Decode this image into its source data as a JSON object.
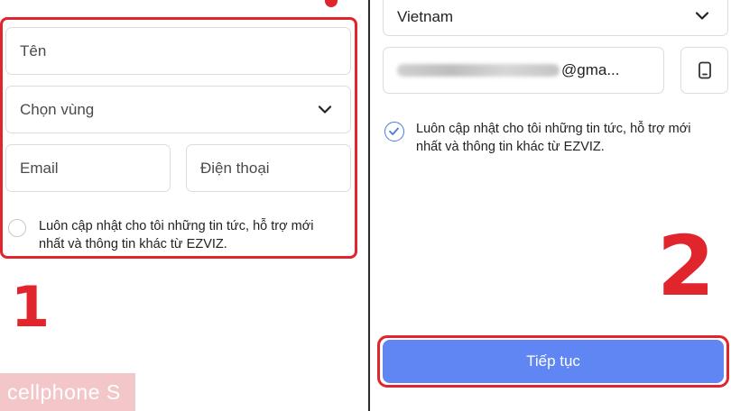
{
  "left_form": {
    "name_placeholder": "Tên",
    "region_placeholder": "Chọn vùng",
    "email_placeholder": "Email",
    "phone_placeholder": "Điện thoại",
    "consent_line1": "Luôn cập nhật cho tôi những tin tức, hỗ trợ mới",
    "consent_line2": "nhất và thông tin khác từ EZVIZ.",
    "consent_checked": false,
    "step_number": "1"
  },
  "right_form": {
    "region_value": "Vietnam",
    "email_value_visible": "@gma...",
    "consent_line1": "Luôn cập nhật cho tôi những tin tức, hỗ trợ mới",
    "consent_line2": "nhất và thông tin khác từ EZVIZ.",
    "consent_checked": true,
    "step_number": "2",
    "continue_label": "Tiếp tục"
  },
  "watermark": {
    "text": "cellphone S"
  },
  "colors": {
    "highlight_red": "#e0252c",
    "primary_button": "#5f86f3",
    "check_blue": "#4a78e8",
    "watermark_bg": "#f3c7c9"
  },
  "icons": {
    "dropdown": "chevron-down-icon",
    "switch_input": "phone-device-icon",
    "consent_checked": "check-circle-icon"
  }
}
